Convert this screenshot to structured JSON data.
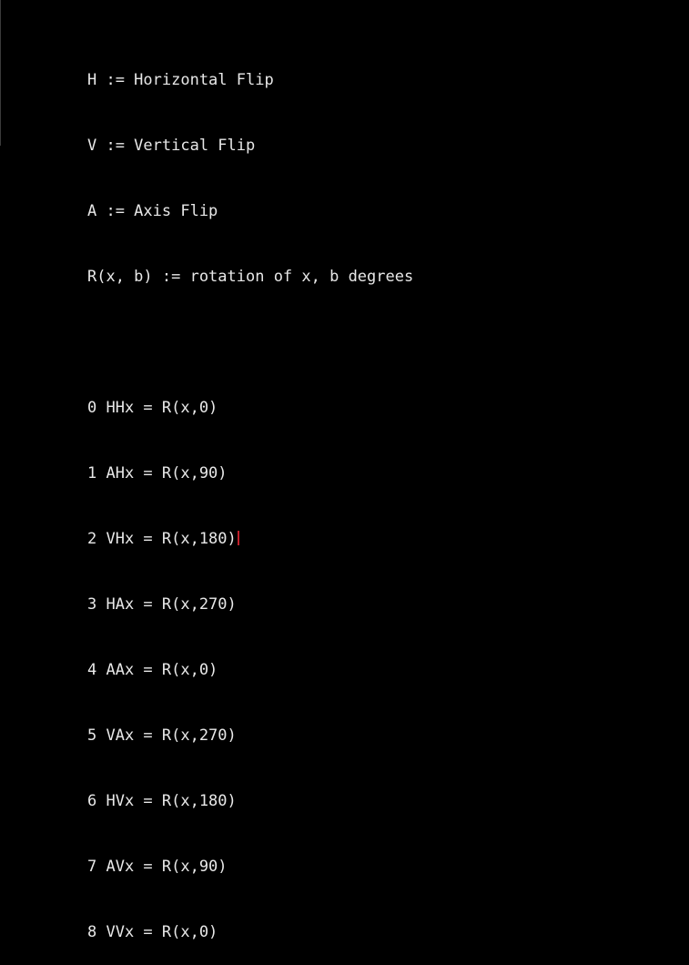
{
  "definitions": [
    "H := Horizontal Flip",
    "V := Vertical Flip",
    "A := Axis Flip",
    "R(x, b) := rotation of x, b degrees"
  ],
  "equations": [
    "0 HHx = R(x,0)",
    "1 AHx = R(x,90)",
    "2 VHx = R(x,180)",
    "3 HAx = R(x,270)",
    "4 AAx = R(x,0)",
    "5 VAx = R(x,270)",
    "6 HVx = R(x,180)",
    "7 AVx = R(x,90)",
    "8 VVx = R(x,0)"
  ],
  "colors": {
    "background": "#000000",
    "text": "#e8e8e8",
    "cursor": "#c0202a"
  }
}
